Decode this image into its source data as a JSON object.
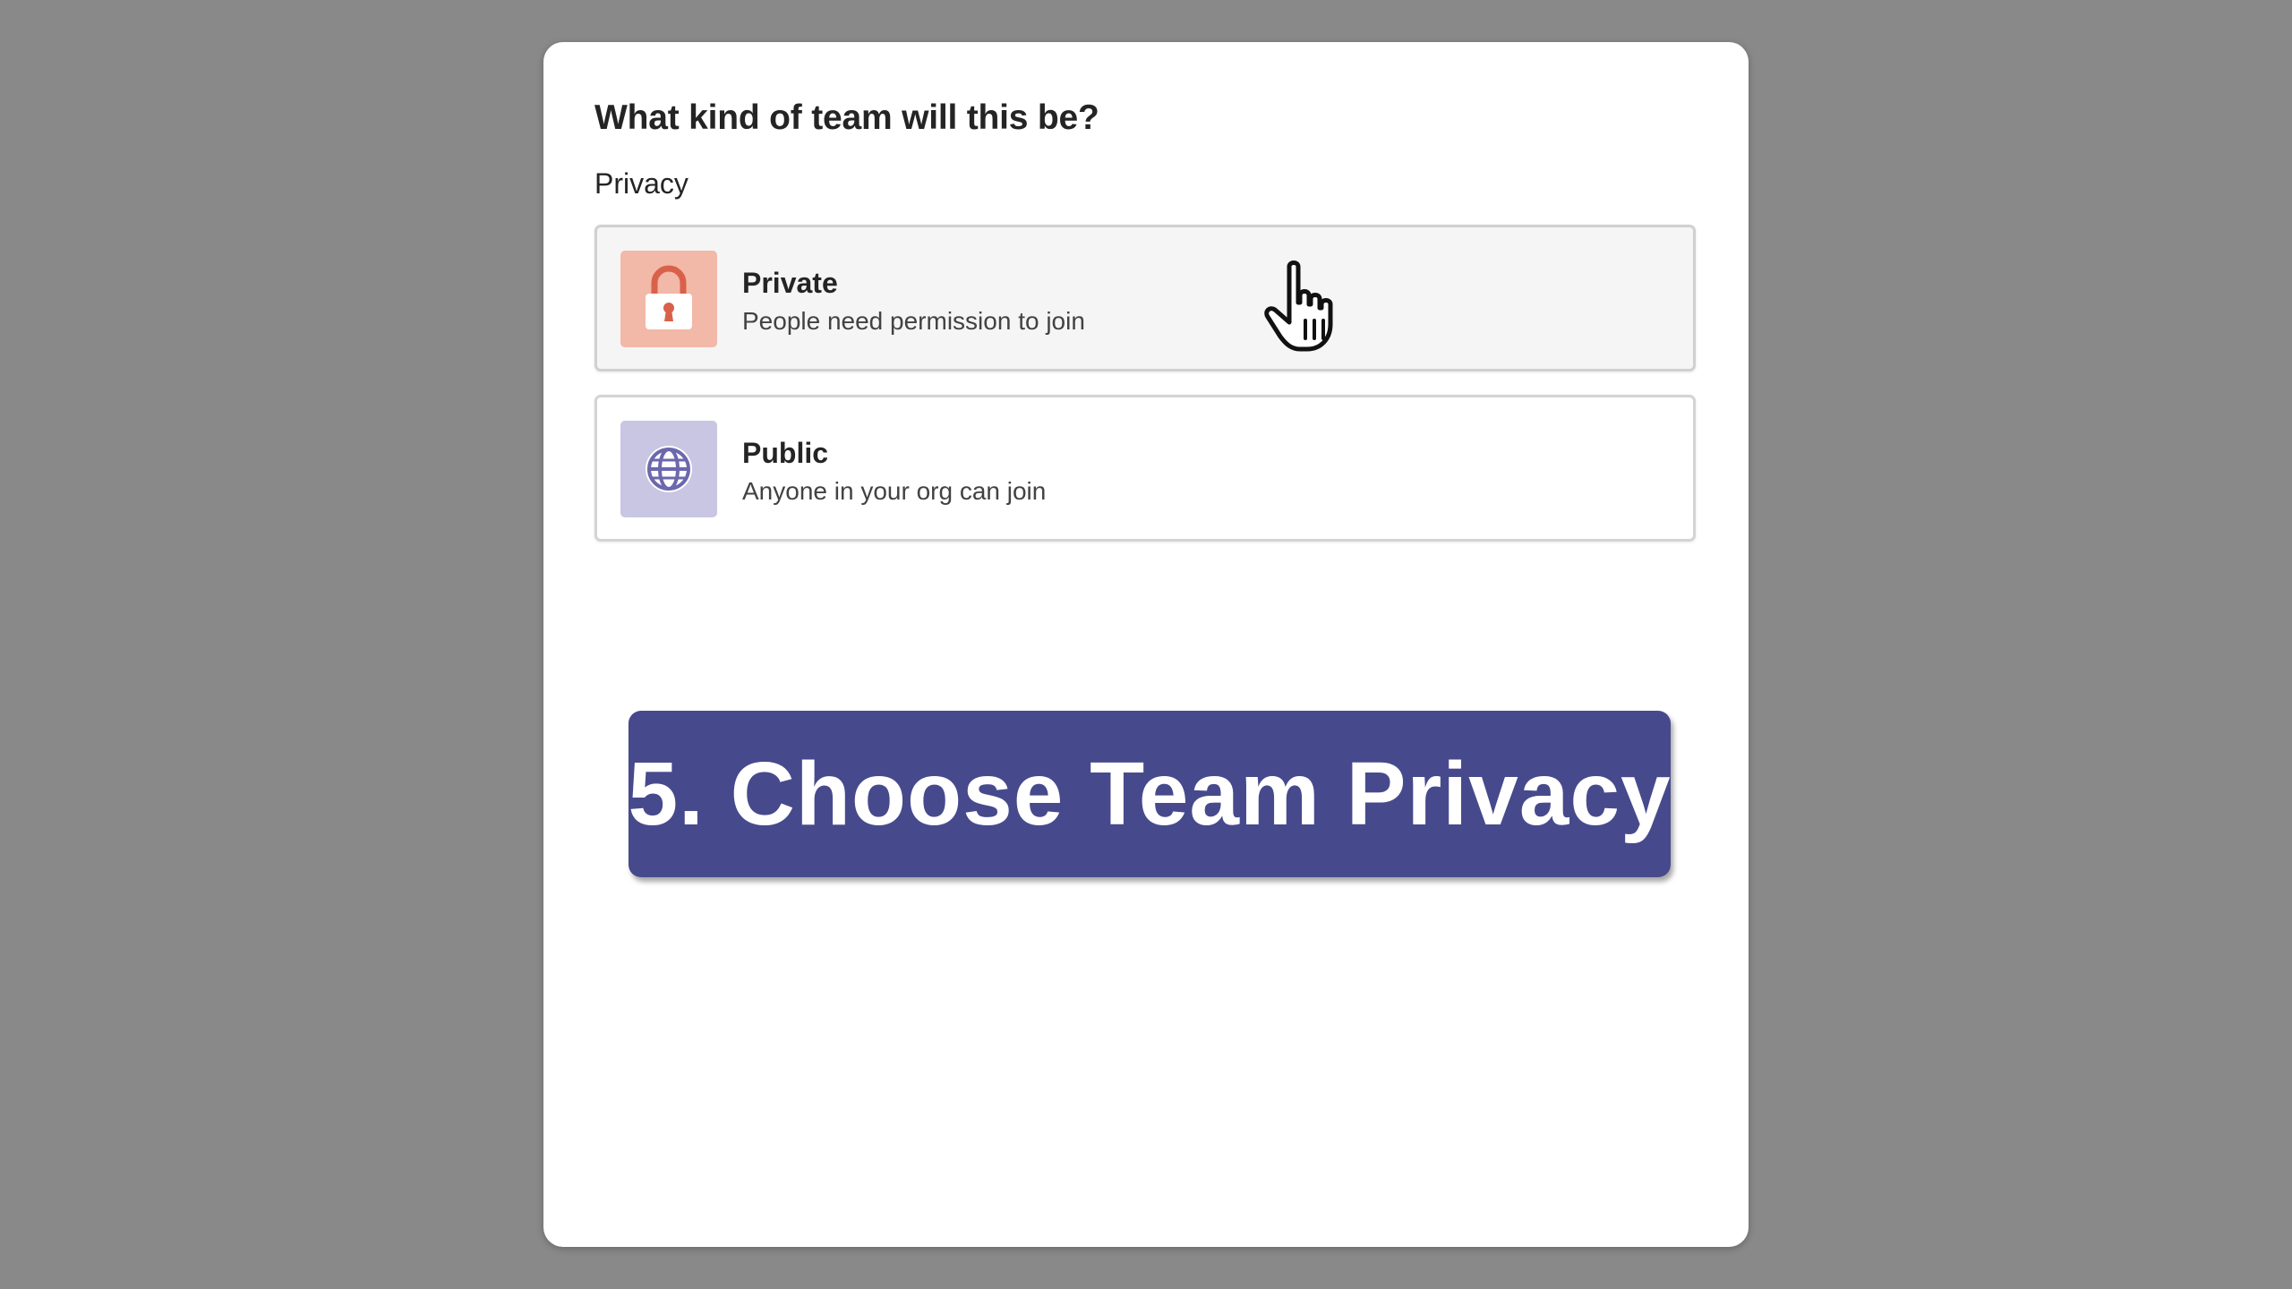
{
  "dialog": {
    "title": "What kind of team will this be?",
    "section_label": "Privacy"
  },
  "options": [
    {
      "name": "Private",
      "description": "People need permission to join",
      "icon": "lock-icon",
      "icon_bg": "#f2b8a8",
      "icon_color": "#d9614a",
      "hovered": true
    },
    {
      "name": "Public",
      "description": "Anyone in your org can join",
      "icon": "globe-icon",
      "icon_bg": "#c9c6e3",
      "icon_color": "#6b68ad"
    }
  ],
  "banner": {
    "text": "5. Choose Team Privacy",
    "color": "#464a8c"
  },
  "cursor": {
    "icon": "hand-pointer-icon"
  }
}
